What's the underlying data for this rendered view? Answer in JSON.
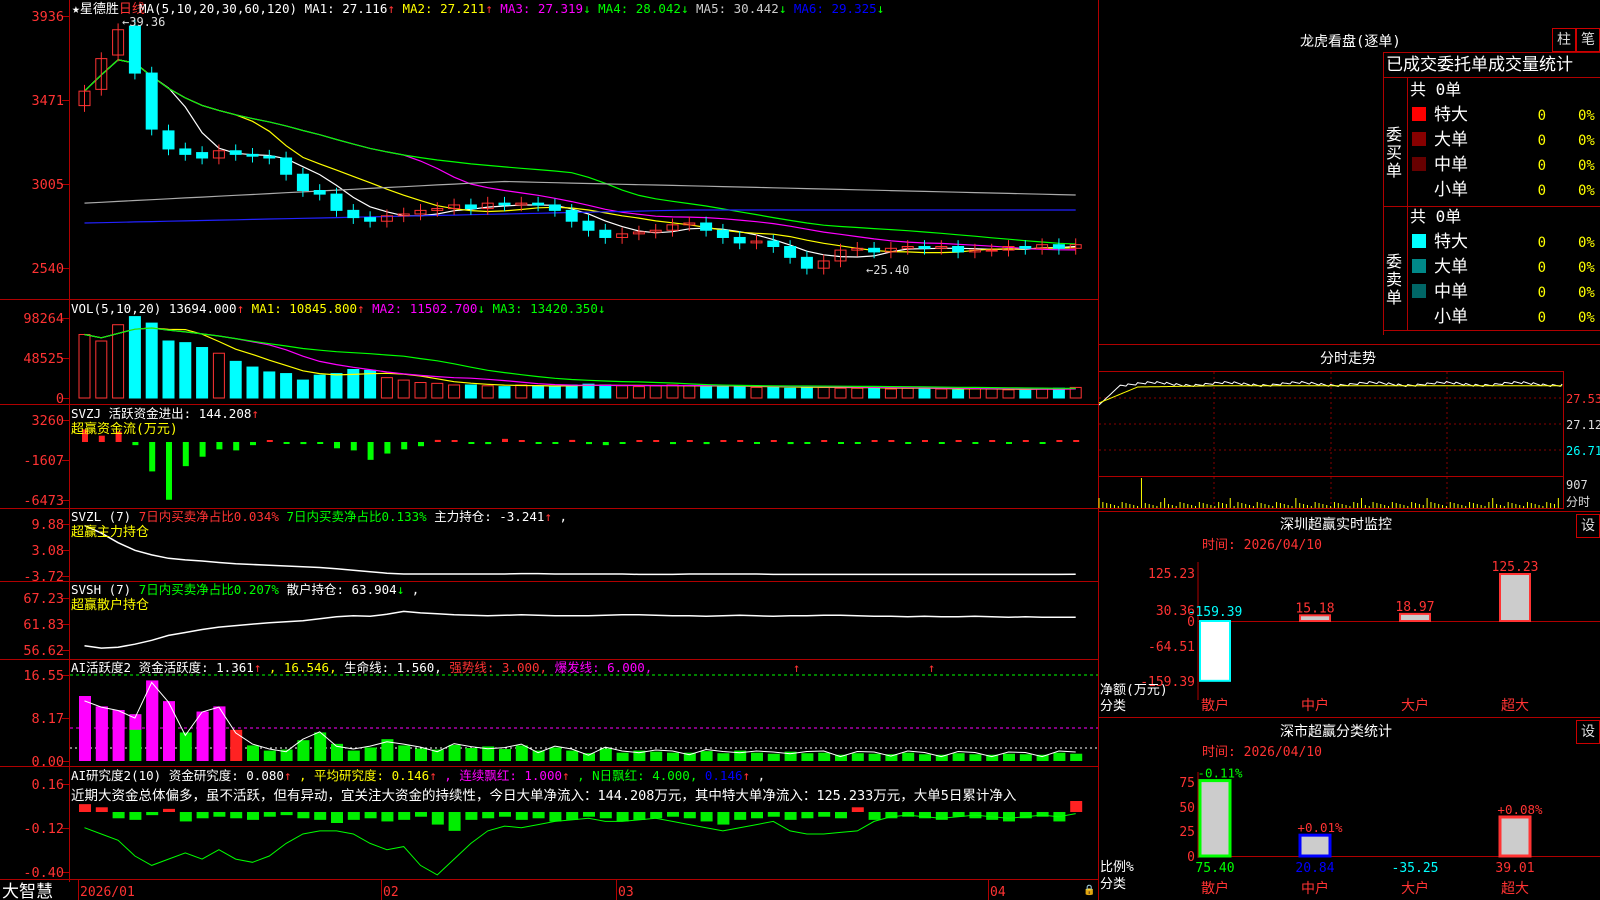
{
  "stock": {
    "name": "★星德胜",
    "period": "日线",
    "high_mark": "39.36",
    "low_mark": "25.40"
  },
  "price_axis": [
    "3936",
    "3471",
    "3005",
    "2540"
  ],
  "ma_legend": [
    {
      "text": "MA(5,10,20,30,60,120)",
      "color": "#ffffff"
    },
    {
      "text": "MA1: 27.116",
      "arrow": "↑",
      "color": "#ffffff"
    },
    {
      "text": "MA2: 27.211",
      "arrow": "↑",
      "color": "#ffff00"
    },
    {
      "text": "MA3: 27.319",
      "arrow": "↓",
      "color": "#ff00ff"
    },
    {
      "text": "MA4: 28.042",
      "arrow": "↓",
      "color": "#00ff00"
    },
    {
      "text": "MA5: 30.442",
      "arrow": "↓",
      "color": "#cccccc"
    },
    {
      "text": "MA6: 29.325",
      "arrow": "↓",
      "color": "#0000ff"
    }
  ],
  "vol": {
    "legend": [
      {
        "text": "VOL(5,10,20)",
        "color": "#ffffff"
      },
      {
        "text": "13694.000",
        "arrow": "↑",
        "color": "#ffffff"
      },
      {
        "text": "MA1: 10845.800",
        "arrow": "↑",
        "color": "#ffff00"
      },
      {
        "text": "MA2: 11502.700",
        "arrow": "↓",
        "color": "#ff00ff"
      },
      {
        "text": "MA3: 13420.350",
        "arrow": "↓",
        "color": "#00ff00"
      }
    ],
    "axis": [
      "98264",
      "48525",
      "0"
    ]
  },
  "svzj": {
    "legend": [
      {
        "text": "SVZJ",
        "color": "#ffffff"
      },
      {
        "text": "活跃资金进出: 144.208",
        "arrow": "↑",
        "color": "#ffffff"
      }
    ],
    "subtitle": "超赢资金流(万元)",
    "axis": [
      "3260",
      "-1607",
      "-6473"
    ]
  },
  "svzl": {
    "legend": [
      {
        "text": "SVZL (7)",
        "color": "#ffffff"
      },
      {
        "text": "7日内买卖净占比0.034%",
        "color": "#ff3333"
      },
      {
        "text": "7日内买卖净占比0.133%",
        "color": "#00ff00"
      },
      {
        "text": "主力持仓: -3.241",
        "arrow": "↑",
        "color": "#ffffff"
      },
      {
        "text": ",",
        "color": "#ffffff"
      }
    ],
    "subtitle": "超赢主力持仓",
    "axis": [
      "9.88",
      "3.08",
      "-3.72"
    ]
  },
  "svsh": {
    "legend": [
      {
        "text": "SVSH (7)",
        "color": "#ffffff"
      },
      {
        "text": "7日内买卖净占比0.207%",
        "color": "#00ff00"
      },
      {
        "text": "散户持仓: 63.904",
        "arrow": "↓",
        "color": "#ffffff"
      },
      {
        "text": ",",
        "color": "#ffffff"
      }
    ],
    "subtitle": "超赢散户持仓",
    "axis": [
      "67.23",
      "61.83",
      "56.62"
    ]
  },
  "ai1": {
    "legend": [
      {
        "text": "AI活跃度2",
        "color": "#ffffff"
      },
      {
        "text": "资金活跃度: 1.361",
        "arrow": "↑",
        "color": "#ffffff"
      },
      {
        "text": ", 16.546, ",
        "color": "#ffff00"
      },
      {
        "text": "生命线: 1.560, ",
        "color": "#ffffff"
      },
      {
        "text": "强势线: 3.000, ",
        "color": "#ff3333"
      },
      {
        "text": "爆发线: 6.000,",
        "color": "#ff00ff"
      }
    ],
    "axis": [
      "16.55",
      "8.17",
      "0.00"
    ]
  },
  "ai2": {
    "legend": [
      {
        "text": "AI研究度2(10)",
        "color": "#ffffff"
      },
      {
        "text": "资金研究度: 0.080",
        "arrow": "↑",
        "color": "#ffffff"
      },
      {
        "text": ", 平均研究度: 0.146",
        "arrow": "↑",
        "color": "#ffff00"
      },
      {
        "text": ", 连续飘红: 1.000",
        "arrow": "↑",
        "color": "#ff00ff"
      },
      {
        "text": ", N日飘红: 4.000, ",
        "color": "#00ff00"
      },
      {
        "text": "0.146",
        "arrow": "↑",
        "color": "#0000ff"
      },
      {
        "text": ",",
        "color": "#ffffff"
      }
    ],
    "axis": [
      "0.16",
      "-0.12",
      "-0.40"
    ],
    "commentary": "近期大资金总体偏多，虽不活跃，但有异动，宜关注大资金的持续性，今日大单净流入：144.208万元，其中特大单净流入：125.233万元，大单5日累计净入"
  },
  "date_axis": [
    "2026/01",
    "02",
    "03",
    "04"
  ],
  "brand": "大智慧",
  "longhu": {
    "title": "龙虎看盘(逐单)",
    "tabs": [
      "柱",
      "笔"
    ],
    "subtitle": "已成交委托单成交量统计",
    "buy": {
      "side": "委买单",
      "total": "共 0单",
      "rows": [
        {
          "label": "特大",
          "count": "0",
          "pct": "0%",
          "color": "#ff0000"
        },
        {
          "label": "大单",
          "count": "0",
          "pct": "0%",
          "color": "#880000"
        },
        {
          "label": "中单",
          "count": "0",
          "pct": "0%",
          "color": "#660000"
        },
        {
          "label": "小单",
          "count": "0",
          "pct": "0%",
          "color": ""
        }
      ]
    },
    "sell": {
      "side": "委卖单",
      "total": "共 0单",
      "rows": [
        {
          "label": "特大",
          "count": "0",
          "pct": "0%",
          "color": "#00ffff"
        },
        {
          "label": "大单",
          "count": "0",
          "pct": "0%",
          "color": "#008888"
        },
        {
          "label": "中单",
          "count": "0",
          "pct": "0%",
          "color": "#006666"
        },
        {
          "label": "小单",
          "count": "0",
          "pct": "0%",
          "color": ""
        }
      ]
    }
  },
  "intraday": {
    "title": "分时走势",
    "axis": [
      "27.53",
      "27.12",
      "26.71"
    ],
    "vol_label": "907",
    "vol_unit": "分时"
  },
  "sz_monitor": {
    "title": "深圳超赢实时监控",
    "settings": "设",
    "date": "时间: 2026/04/10",
    "axis": [
      "125.23",
      "30.36",
      "0",
      "-64.51",
      "-159.39"
    ],
    "unit": "净额(万元)",
    "cat_label": "分类",
    "categories": [
      "散户",
      "中户",
      "大户",
      "超大"
    ],
    "value_labels": [
      "-159.39",
      "15.18",
      "18.97",
      "125.23"
    ],
    "chart_data": {
      "type": "bar",
      "categories": [
        "散户",
        "中户",
        "大户",
        "超大"
      ],
      "values": [
        -159.39,
        15.18,
        18.97,
        125.23
      ],
      "ylabel": "净额(万元)",
      "ylim": [
        -159.39,
        125.23
      ]
    }
  },
  "sz_classify": {
    "title": "深市超赢分类统计",
    "settings": "设",
    "date": "时间: 2026/04/10",
    "axis": [
      "75",
      "50",
      "25",
      "0"
    ],
    "unit": "比例%",
    "cat_label": "分类",
    "categories": [
      "散户",
      "中户",
      "大户",
      "超大"
    ],
    "top_labels": [
      "-0.11%",
      "+0.01%",
      "",
      "+0.08%"
    ],
    "bottom_labels": [
      "75.40",
      "20.84",
      "-35.25",
      "39.01"
    ],
    "chart_data": {
      "type": "bar",
      "categories": [
        "散户",
        "中户",
        "大户",
        "超大"
      ],
      "values": [
        75.4,
        20.84,
        -35.25,
        39.01
      ],
      "changes": [
        "-0.11%",
        "+0.01%",
        "",
        "+0.08%"
      ],
      "ylabel": "比例%",
      "ylim": [
        0,
        75
      ]
    }
  },
  "colors": {
    "up": "#ff3333",
    "down": "#00ffff",
    "grid": "#aa0000"
  }
}
